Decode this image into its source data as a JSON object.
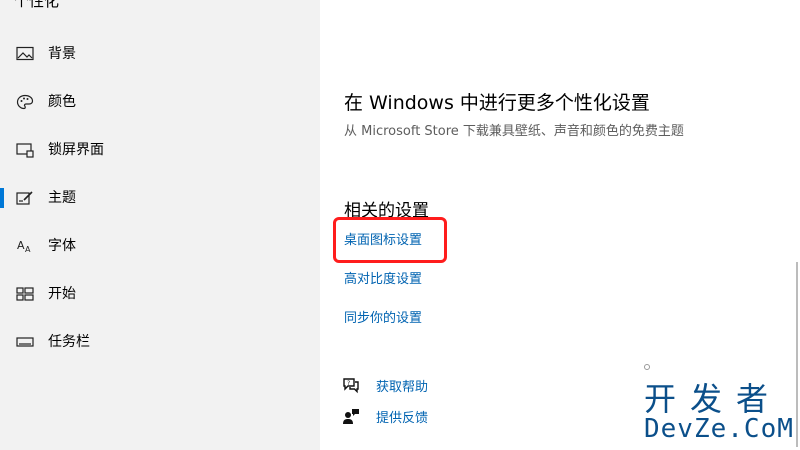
{
  "sidebar": {
    "top_fragment": "个性化",
    "items": [
      {
        "label": "背景",
        "icon": "image-icon",
        "selected": false
      },
      {
        "label": "颜色",
        "icon": "palette-icon",
        "selected": false
      },
      {
        "label": "锁屏界面",
        "icon": "lock-screen-icon",
        "selected": false
      },
      {
        "label": "主题",
        "icon": "theme-icon",
        "selected": true
      },
      {
        "label": "字体",
        "icon": "font-icon",
        "selected": false
      },
      {
        "label": "开始",
        "icon": "start-icon",
        "selected": false
      },
      {
        "label": "任务栏",
        "icon": "taskbar-icon",
        "selected": false
      }
    ]
  },
  "main": {
    "more_personalization": {
      "title": "在 Windows 中进行更多个性化设置",
      "description": "从 Microsoft Store 下载兼具壁纸、声音和颜色的免费主题"
    },
    "related_settings": {
      "title": "相关的设置",
      "links": [
        "桌面图标设置",
        "高对比度设置",
        "同步你的设置"
      ]
    },
    "help": {
      "get_help": "获取帮助",
      "give_feedback": "提供反馈"
    }
  },
  "watermark": {
    "line1": "开发者",
    "line2": "DevZe.CoM"
  },
  "colors": {
    "accent": "#0078d7",
    "link": "#0063b1",
    "highlight": "#ff1d1d",
    "sidebar_bg": "#f2f2f2"
  }
}
